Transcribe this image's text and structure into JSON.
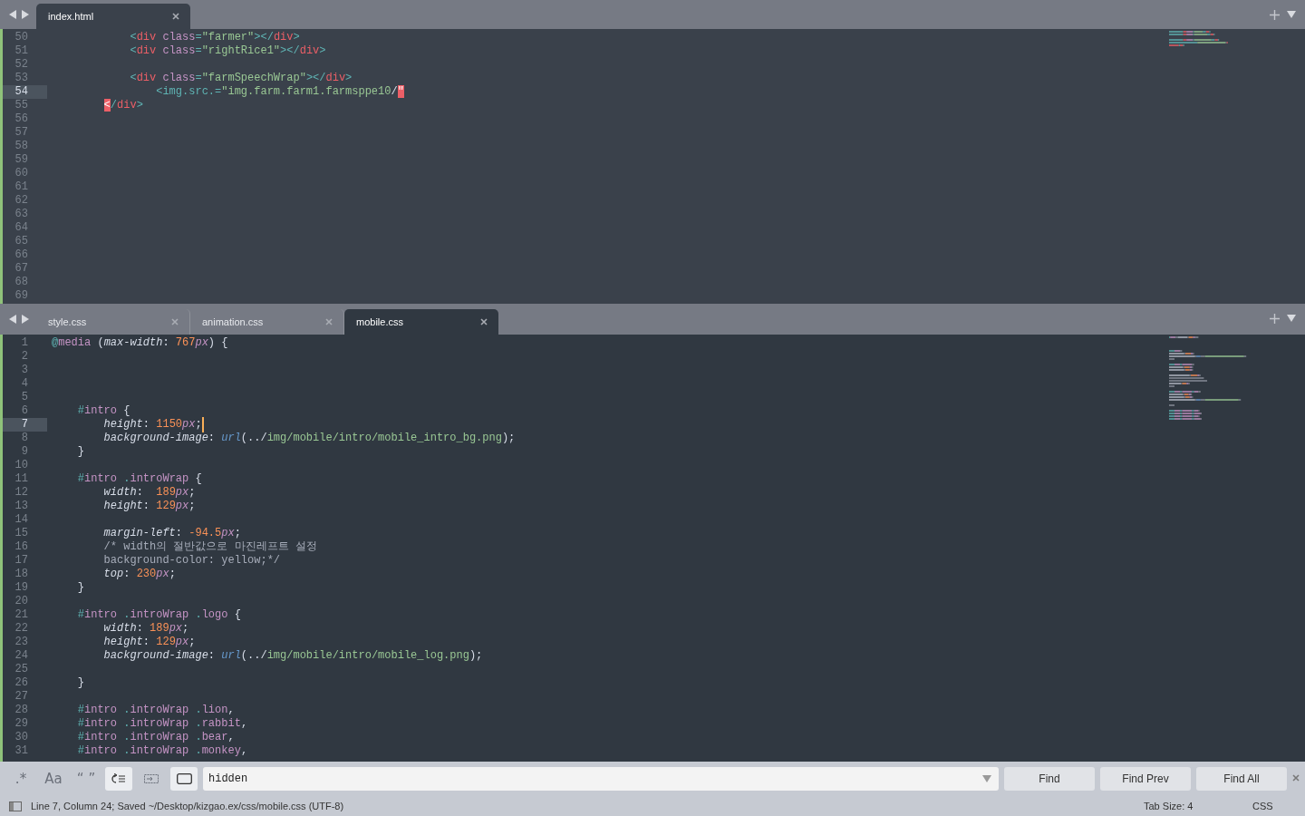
{
  "panes": [
    {
      "tabs": [
        {
          "label": "index.html",
          "selected": true
        }
      ],
      "lines": [
        {
          "number": "50",
          "current": false,
          "cursor": false,
          "tokens": [
            {
              "kind": "punct",
              "text": "            <"
            },
            {
              "kind": "tag",
              "text": "div"
            },
            {
              "kind": "attr",
              "text": " class"
            },
            {
              "kind": "punct",
              "text": "="
            },
            {
              "kind": "string",
              "text": "\"farmer\""
            },
            {
              "kind": "punct",
              "text": "></"
            },
            {
              "kind": "tag",
              "text": "div"
            },
            {
              "kind": "punct",
              "text": ">"
            }
          ]
        },
        {
          "number": "51",
          "current": false,
          "cursor": false,
          "tokens": [
            {
              "kind": "punct",
              "text": "            <"
            },
            {
              "kind": "tag",
              "text": "div"
            },
            {
              "kind": "attr",
              "text": " class"
            },
            {
              "kind": "punct",
              "text": "="
            },
            {
              "kind": "string",
              "text": "\"rightRice1\""
            },
            {
              "kind": "punct",
              "text": "></"
            },
            {
              "kind": "tag",
              "text": "div"
            },
            {
              "kind": "punct",
              "text": ">"
            }
          ]
        },
        {
          "number": "52",
          "current": false,
          "cursor": false
        },
        {
          "number": "53",
          "current": false,
          "cursor": false,
          "tokens": [
            {
              "kind": "punct",
              "text": "            <"
            },
            {
              "kind": "tag",
              "text": "div"
            },
            {
              "kind": "attr",
              "text": " class"
            },
            {
              "kind": "punct",
              "text": "="
            },
            {
              "kind": "string",
              "text": "\"farmSpeechWrap\""
            },
            {
              "kind": "punct",
              "text": "></"
            },
            {
              "kind": "tag",
              "text": "div"
            },
            {
              "kind": "punct",
              "text": ">"
            }
          ]
        },
        {
          "number": "54",
          "current": true,
          "cursor": false,
          "tokens": [
            {
              "kind": "punct",
              "text": "                <img.src.="
            },
            {
              "kind": "string",
              "text": "\"img.farm.farm1.farmsppe10"
            },
            {
              "kind": "plain",
              "text": "/"
            },
            {
              "kind": "error",
              "text": "\""
            }
          ]
        },
        {
          "number": "55",
          "current": false,
          "cursor": false,
          "tokens": [
            {
              "kind": "error",
              "text": "        <"
            },
            {
              "kind": "punct",
              "text": "/"
            },
            {
              "kind": "tag",
              "text": "div"
            },
            {
              "kind": "punct",
              "text": ">"
            }
          ]
        },
        {
          "number": "56",
          "current": false,
          "cursor": false
        },
        {
          "number": "57",
          "current": false,
          "cursor": false
        },
        {
          "number": "58",
          "current": false,
          "cursor": false
        },
        {
          "number": "59",
          "current": false,
          "cursor": false
        },
        {
          "number": "60",
          "current": false,
          "cursor": false
        },
        {
          "number": "61",
          "current": false,
          "cursor": false
        },
        {
          "number": "62",
          "current": false,
          "cursor": false
        },
        {
          "number": "63",
          "current": false,
          "cursor": false
        },
        {
          "number": "64",
          "current": false,
          "cursor": false
        },
        {
          "number": "65",
          "current": false,
          "cursor": false
        },
        {
          "number": "66",
          "current": false,
          "cursor": false
        },
        {
          "number": "67",
          "current": false,
          "cursor": false
        },
        {
          "number": "68",
          "current": false,
          "cursor": false
        },
        {
          "number": "69",
          "current": false,
          "cursor": false
        }
      ]
    },
    {
      "tabs": [
        {
          "label": "style.css",
          "selected": false
        },
        {
          "label": "animation.css",
          "selected": false
        },
        {
          "label": "mobile.css",
          "selected": true
        }
      ],
      "lines": [
        {
          "number": "1",
          "current": false,
          "cursor": false,
          "tokens": [
            {
              "kind": "punct",
              "text": "@"
            },
            {
              "kind": "attr",
              "text": "media"
            },
            {
              "kind": "plain",
              "text": " ("
            },
            {
              "kind": "prop",
              "text": "max-width"
            },
            {
              "kind": "plain",
              "text": ":"
            },
            {
              "kind": "number",
              "text": " 767"
            },
            {
              "kind": "unit",
              "text": "px"
            },
            {
              "kind": "plain",
              "text": ") {"
            }
          ]
        },
        {
          "number": "2",
          "current": false,
          "cursor": false
        },
        {
          "number": "3",
          "current": false,
          "cursor": false
        },
        {
          "number": "4",
          "current": false,
          "cursor": false
        },
        {
          "number": "5",
          "current": false,
          "cursor": false
        },
        {
          "number": "6",
          "current": false,
          "cursor": false,
          "tokens": [
            {
              "kind": "punct",
              "text": "    #"
            },
            {
              "kind": "attr",
              "text": "intro"
            },
            {
              "kind": "plain",
              "text": " {"
            }
          ]
        },
        {
          "number": "7",
          "current": true,
          "cursor": true,
          "tokens": [
            {
              "kind": "prop",
              "text": "        height"
            },
            {
              "kind": "plain",
              "text": ":"
            },
            {
              "kind": "number",
              "text": " 1150"
            },
            {
              "kind": "unit",
              "text": "px"
            },
            {
              "kind": "plain",
              "text": ";"
            }
          ]
        },
        {
          "number": "8",
          "current": false,
          "cursor": false,
          "tokens": [
            {
              "kind": "prop",
              "text": "        background-image"
            },
            {
              "kind": "plain",
              "text": ":"
            },
            {
              "kind": "func",
              "text": " url"
            },
            {
              "kind": "plain",
              "text": "(../"
            },
            {
              "kind": "string",
              "text": "img/mobile/intro/mobile_intro_bg.png"
            },
            {
              "kind": "plain",
              "text": ");"
            }
          ]
        },
        {
          "number": "9",
          "current": false,
          "cursor": false,
          "tokens": [
            {
              "kind": "plain",
              "text": "    }"
            }
          ]
        },
        {
          "number": "10",
          "current": false,
          "cursor": false
        },
        {
          "number": "11",
          "current": false,
          "cursor": false,
          "tokens": [
            {
              "kind": "punct",
              "text": "    #"
            },
            {
              "kind": "attr",
              "text": "intro"
            },
            {
              "kind": "punct",
              "text": " ."
            },
            {
              "kind": "attr",
              "text": "introWrap"
            },
            {
              "kind": "plain",
              "text": " {"
            }
          ]
        },
        {
          "number": "12",
          "current": false,
          "cursor": false,
          "tokens": [
            {
              "kind": "prop",
              "text": "        width"
            },
            {
              "kind": "plain",
              "text": ":"
            },
            {
              "kind": "number",
              "text": "  189"
            },
            {
              "kind": "unit",
              "text": "px"
            },
            {
              "kind": "plain",
              "text": ";"
            }
          ]
        },
        {
          "number": "13",
          "current": false,
          "cursor": false,
          "tokens": [
            {
              "kind": "prop",
              "text": "        height"
            },
            {
              "kind": "plain",
              "text": ":"
            },
            {
              "kind": "number",
              "text": " 129"
            },
            {
              "kind": "unit",
              "text": "px"
            },
            {
              "kind": "plain",
              "text": ";"
            }
          ]
        },
        {
          "number": "14",
          "current": false,
          "cursor": false
        },
        {
          "number": "15",
          "current": false,
          "cursor": false,
          "tokens": [
            {
              "kind": "prop",
              "text": "        margin-left"
            },
            {
              "kind": "plain",
              "text": ":"
            },
            {
              "kind": "number",
              "text": " -94.5"
            },
            {
              "kind": "unit",
              "text": "px"
            },
            {
              "kind": "plain",
              "text": ";"
            }
          ]
        },
        {
          "number": "16",
          "current": false,
          "cursor": false,
          "tokens": [
            {
              "kind": "comment",
              "text": "        /* width의 절반값으로 마진레프트 설정"
            }
          ]
        },
        {
          "number": "17",
          "current": false,
          "cursor": false,
          "tokens": [
            {
              "kind": "comment",
              "text": "        background-color: yellow;*/"
            }
          ]
        },
        {
          "number": "18",
          "current": false,
          "cursor": false,
          "tokens": [
            {
              "kind": "prop",
              "text": "        top"
            },
            {
              "kind": "plain",
              "text": ":"
            },
            {
              "kind": "number",
              "text": " 230"
            },
            {
              "kind": "unit",
              "text": "px"
            },
            {
              "kind": "plain",
              "text": ";"
            }
          ]
        },
        {
          "number": "19",
          "current": false,
          "cursor": false,
          "tokens": [
            {
              "kind": "plain",
              "text": "    }"
            }
          ]
        },
        {
          "number": "20",
          "current": false,
          "cursor": false
        },
        {
          "number": "21",
          "current": false,
          "cursor": false,
          "tokens": [
            {
              "kind": "punct",
              "text": "    #"
            },
            {
              "kind": "attr",
              "text": "intro"
            },
            {
              "kind": "punct",
              "text": " ."
            },
            {
              "kind": "attr",
              "text": "introWrap"
            },
            {
              "kind": "punct",
              "text": " ."
            },
            {
              "kind": "attr",
              "text": "logo"
            },
            {
              "kind": "plain",
              "text": " {"
            }
          ]
        },
        {
          "number": "22",
          "current": false,
          "cursor": false,
          "tokens": [
            {
              "kind": "prop",
              "text": "        width"
            },
            {
              "kind": "plain",
              "text": ":"
            },
            {
              "kind": "number",
              "text": " 189"
            },
            {
              "kind": "unit",
              "text": "px"
            },
            {
              "kind": "plain",
              "text": ";"
            }
          ]
        },
        {
          "number": "23",
          "current": false,
          "cursor": false,
          "tokens": [
            {
              "kind": "prop",
              "text": "        height"
            },
            {
              "kind": "plain",
              "text": ":"
            },
            {
              "kind": "number",
              "text": " 129"
            },
            {
              "kind": "unit",
              "text": "px"
            },
            {
              "kind": "plain",
              "text": ";"
            }
          ]
        },
        {
          "number": "24",
          "current": false,
          "cursor": false,
          "tokens": [
            {
              "kind": "prop",
              "text": "        background-image"
            },
            {
              "kind": "plain",
              "text": ":"
            },
            {
              "kind": "func",
              "text": " url"
            },
            {
              "kind": "plain",
              "text": "(../"
            },
            {
              "kind": "string",
              "text": "img/mobile/intro/mobile_log.png"
            },
            {
              "kind": "plain",
              "text": ");"
            }
          ]
        },
        {
          "number": "25",
          "current": false,
          "cursor": false
        },
        {
          "number": "26",
          "current": false,
          "cursor": false,
          "tokens": [
            {
              "kind": "plain",
              "text": "    }"
            }
          ]
        },
        {
          "number": "27",
          "current": false,
          "cursor": false
        },
        {
          "number": "28",
          "current": false,
          "cursor": false,
          "tokens": [
            {
              "kind": "punct",
              "text": "    #"
            },
            {
              "kind": "attr",
              "text": "intro"
            },
            {
              "kind": "punct",
              "text": " ."
            },
            {
              "kind": "attr",
              "text": "introWrap"
            },
            {
              "kind": "punct",
              "text": " ."
            },
            {
              "kind": "attr",
              "text": "lion"
            },
            {
              "kind": "plain",
              "text": ","
            }
          ]
        },
        {
          "number": "29",
          "current": false,
          "cursor": false,
          "tokens": [
            {
              "kind": "punct",
              "text": "    #"
            },
            {
              "kind": "attr",
              "text": "intro"
            },
            {
              "kind": "punct",
              "text": " ."
            },
            {
              "kind": "attr",
              "text": "introWrap"
            },
            {
              "kind": "punct",
              "text": " ."
            },
            {
              "kind": "attr",
              "text": "rabbit"
            },
            {
              "kind": "plain",
              "text": ","
            }
          ]
        },
        {
          "number": "30",
          "current": false,
          "cursor": false,
          "tokens": [
            {
              "kind": "punct",
              "text": "    #"
            },
            {
              "kind": "attr",
              "text": "intro"
            },
            {
              "kind": "punct",
              "text": " ."
            },
            {
              "kind": "attr",
              "text": "introWrap"
            },
            {
              "kind": "punct",
              "text": " ."
            },
            {
              "kind": "attr",
              "text": "bear"
            },
            {
              "kind": "plain",
              "text": ","
            }
          ]
        },
        {
          "number": "31",
          "current": false,
          "cursor": false,
          "tokens": [
            {
              "kind": "punct",
              "text": "    #"
            },
            {
              "kind": "attr",
              "text": "intro"
            },
            {
              "kind": "punct",
              "text": " ."
            },
            {
              "kind": "attr",
              "text": "introWrap"
            },
            {
              "kind": "punct",
              "text": " ."
            },
            {
              "kind": "attr",
              "text": "monkey"
            },
            {
              "kind": "plain",
              "text": ","
            }
          ]
        }
      ]
    }
  ],
  "find_bar": {
    "toggles": [
      {
        "kind": "text",
        "label": ".*",
        "on": false
      },
      {
        "kind": "text",
        "label": "Aa",
        "on": false
      },
      {
        "kind": "text",
        "label": "“ ”",
        "on": false
      },
      {
        "kind": "wrap",
        "on": true
      },
      {
        "kind": "in-selection",
        "on": false
      },
      {
        "kind": "highlight",
        "on": true
      }
    ],
    "value": "hidden",
    "buttons": [
      "Find",
      "Find Prev",
      "Find All"
    ]
  },
  "status_bar": {
    "position": "Line 7, Column 24; Saved ~/Desktop/kizgao.ex/css/mobile.css (UTF-8)",
    "tab_size": "Tab Size: 4",
    "syntax": "CSS"
  }
}
